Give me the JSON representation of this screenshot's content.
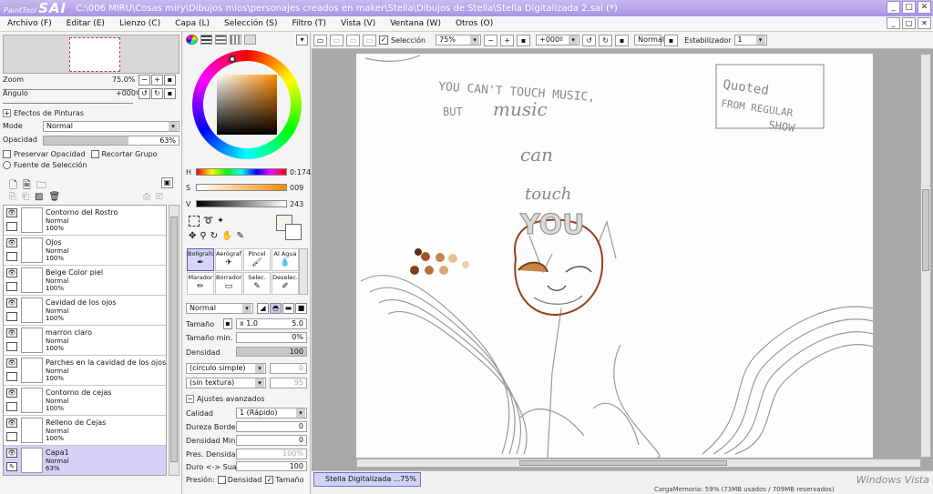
{
  "app": {
    "logo_small": "PaintTool",
    "logo_big": "SAI",
    "title": "C:\\006 MIRU\\Cosas miry\\Dibujos mios\\personajes creados en maker\\Stella\\Dibujos de Stella\\Stella Digitalizada 2.sai (*)"
  },
  "window_buttons": [
    "_",
    "□",
    "✕"
  ],
  "menu": [
    "Archivo (F)",
    "Editar (E)",
    "Lienzo (C)",
    "Capa (L)",
    "Selección (S)",
    "Filtro (T)",
    "Vista (V)",
    "Ventana (W)",
    "Otros (O)"
  ],
  "navigator": {
    "zoom_label": "Zoom",
    "zoom_value": "75.0%",
    "angle_label": "Ángulo",
    "angle_value": "+000º"
  },
  "paint_effects": {
    "header": "Efectos de Pinturas",
    "mode_label": "Mode",
    "mode_value": "Normal",
    "opacity_label": "Opacidad",
    "opacity_value": "63%",
    "opacity_fraction": 0.63,
    "preserve_opacity": "Preservar Opacidad",
    "clip_group": "Recortar Grupo",
    "selection_source": "Fuente de Selección"
  },
  "layers": [
    {
      "name": "Contorno del Rostro",
      "mode": "Normal",
      "opacity": "100%",
      "selected": false
    },
    {
      "name": "Ojos",
      "mode": "Normal",
      "opacity": "100%",
      "selected": false
    },
    {
      "name": "Beige Color piel",
      "mode": "Normal",
      "opacity": "100%",
      "selected": false
    },
    {
      "name": "Cavidad de los ojos",
      "mode": "Normal",
      "opacity": "100%",
      "selected": false
    },
    {
      "name": "marron claro",
      "mode": "Normal",
      "opacity": "100%",
      "selected": false
    },
    {
      "name": "Parches en la cavidad de los ojos",
      "mode": "Normal",
      "opacity": "100%",
      "selected": false
    },
    {
      "name": "Contorno de cejas",
      "mode": "Normal",
      "opacity": "100%",
      "selected": false
    },
    {
      "name": "Relleno de Cejas",
      "mode": "Normal",
      "opacity": "100%",
      "selected": false
    },
    {
      "name": "Capa1",
      "mode": "Normal",
      "opacity": "63%",
      "selected": true
    }
  ],
  "color": {
    "h_label": "H",
    "h_value": "0:174",
    "s_label": "S",
    "s_value": "009",
    "v_label": "V",
    "v_value": "243"
  },
  "tools": [
    {
      "label": "Bolígrafo",
      "icon": "pen-icon",
      "active": true
    },
    {
      "label": "Aerógraf",
      "icon": "airbrush-icon",
      "active": false
    },
    {
      "label": "Pincel",
      "icon": "brush-icon",
      "active": false
    },
    {
      "label": "Al Agua",
      "icon": "water-icon",
      "active": false
    },
    {
      "label": "Marador",
      "icon": "marker-icon",
      "active": false
    },
    {
      "label": "Borrador",
      "icon": "eraser-icon",
      "active": false
    },
    {
      "label": "Selec.",
      "icon": "select-pen-icon",
      "active": false
    },
    {
      "label": "Deselec.",
      "icon": "deselect-icon",
      "active": false
    }
  ],
  "brush": {
    "blend_mode": "Normal",
    "size_label": "Tamaño",
    "size_mult": "x 1.0",
    "size_value": "5.0",
    "min_size_label": "Tamaño min.",
    "min_size_value": "0%",
    "density_label": "Densidad",
    "density_value": "100",
    "shape": "(círculo simple)",
    "shape_value": "0",
    "texture": "(sin textura)",
    "texture_value": "95",
    "advanced_header": "Ajustes avanzados",
    "quality_label": "Calidad",
    "quality_value": "1 (Rápido)",
    "edge_hardness_label": "Dureza Borde",
    "edge_hardness_value": "0",
    "min_density_label": "Densidad Min.",
    "min_density_value": "0",
    "max_pressure_label": "Pres. Densidad I",
    "max_pressure_value": "100%",
    "hard_soft_label": "Duro <-> Suave",
    "hard_soft_value": "100",
    "pressure_label": "Presión:",
    "pressure_density": "Densidad",
    "pressure_size": "Tamaño"
  },
  "canvas_toolbar": {
    "selection_label": "Selección",
    "zoom_value": "75%",
    "angle_value": "+000º",
    "blend_mode": "Normal",
    "stabilizer_label": "Estabilizador",
    "stabilizer_value": "1"
  },
  "drawing_text": {
    "line1": "YOU CAN'T TOUCH MUSIC,",
    "line2": "BUT",
    "line3": "music",
    "line4": "can",
    "line5": "touch",
    "line6": "YOU",
    "quote1": "Quoted",
    "quote2": "FROM REGULAR",
    "quote3": "SHOW"
  },
  "document_tab": {
    "name": "Stella Digitalizada ...",
    "zoom": "75%"
  },
  "status": {
    "memory": "CargaMemoria: 59% (73MB usados / 709MB reservados)",
    "vista_watermark": "Windows Vista"
  },
  "palette_colors": [
    "#A0522D",
    "#C8864A",
    "#E8C090",
    "#7A4020",
    "#B87040",
    "#D8A878",
    "#F0D0A8",
    "#5A3018"
  ]
}
